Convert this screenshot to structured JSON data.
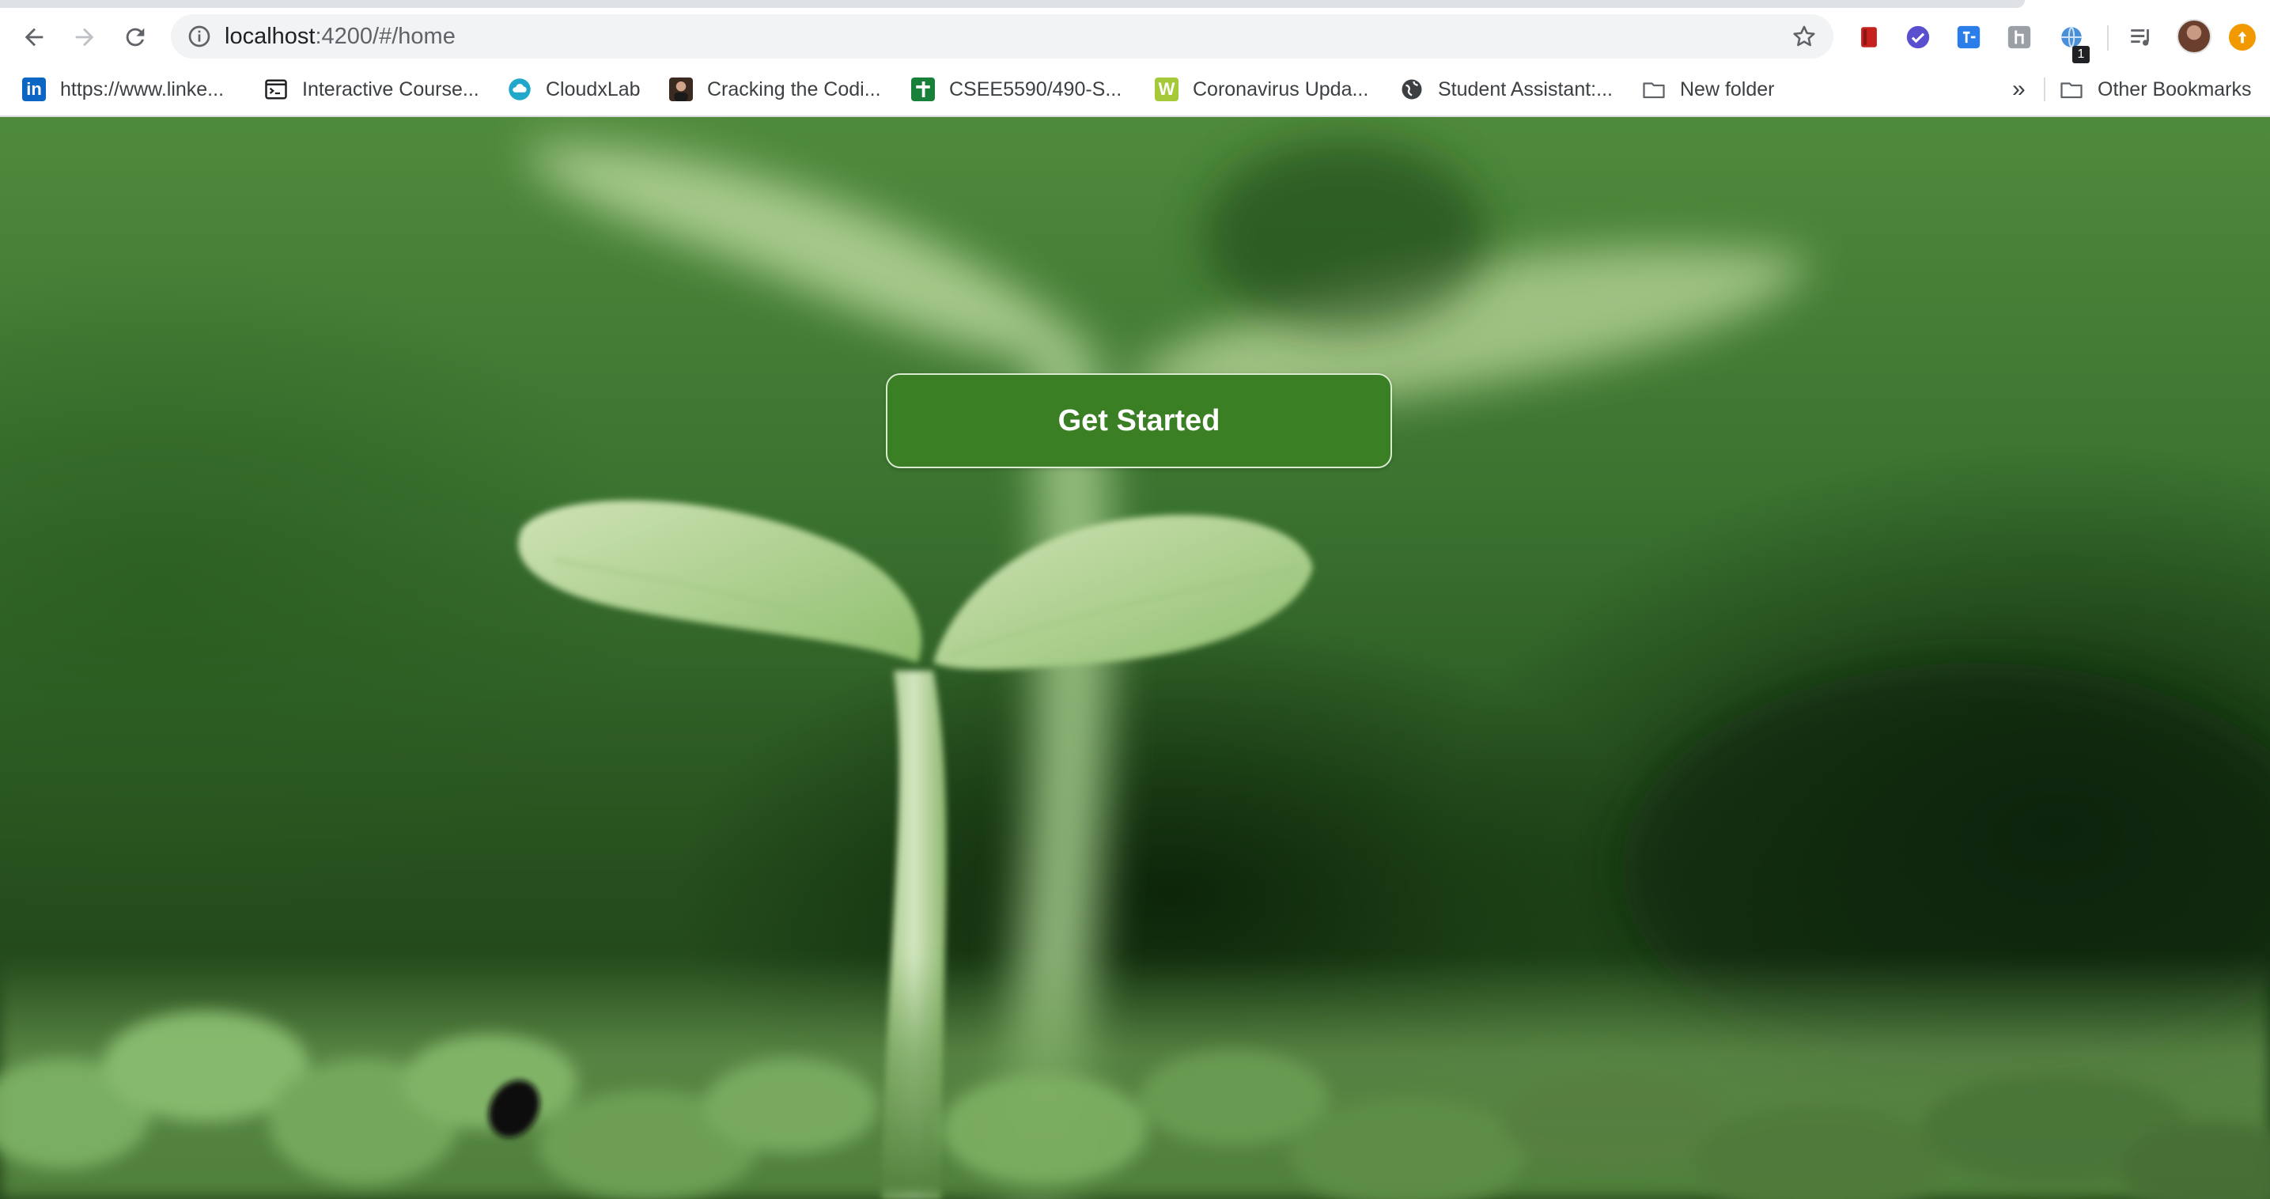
{
  "browser": {
    "url_host": "localhost",
    "url_path": ":4200/#/home",
    "extension_badge": "1",
    "bookmarks": [
      {
        "label": "https://www.linke...",
        "icon": "linkedin-icon",
        "color": "#0a66c2"
      },
      {
        "label": "Interactive Course...",
        "icon": "terminal-window-icon",
        "color": "#202124"
      },
      {
        "label": "CloudxLab",
        "icon": "cloud-icon",
        "color": "#21a7c9"
      },
      {
        "label": "Cracking the Codi...",
        "icon": "author-portrait-icon",
        "color": "#3b2a20"
      },
      {
        "label": "CSEE5590/490-S...",
        "icon": "green-cross-icon",
        "color": "#188038"
      },
      {
        "label": "Coronavirus Upda...",
        "icon": "w-logo-icon",
        "color": "#a6c93a"
      },
      {
        "label": "Student Assistant:...",
        "icon": "globe-icon",
        "color": "#3c4043"
      },
      {
        "label": "New folder",
        "icon": "folder-icon",
        "color": "#5f6368"
      }
    ],
    "overflow_label": "»",
    "other_bookmarks_label": "Other Bookmarks"
  },
  "page": {
    "cta_label": "Get Started",
    "cta_color": "#3a7f24"
  }
}
